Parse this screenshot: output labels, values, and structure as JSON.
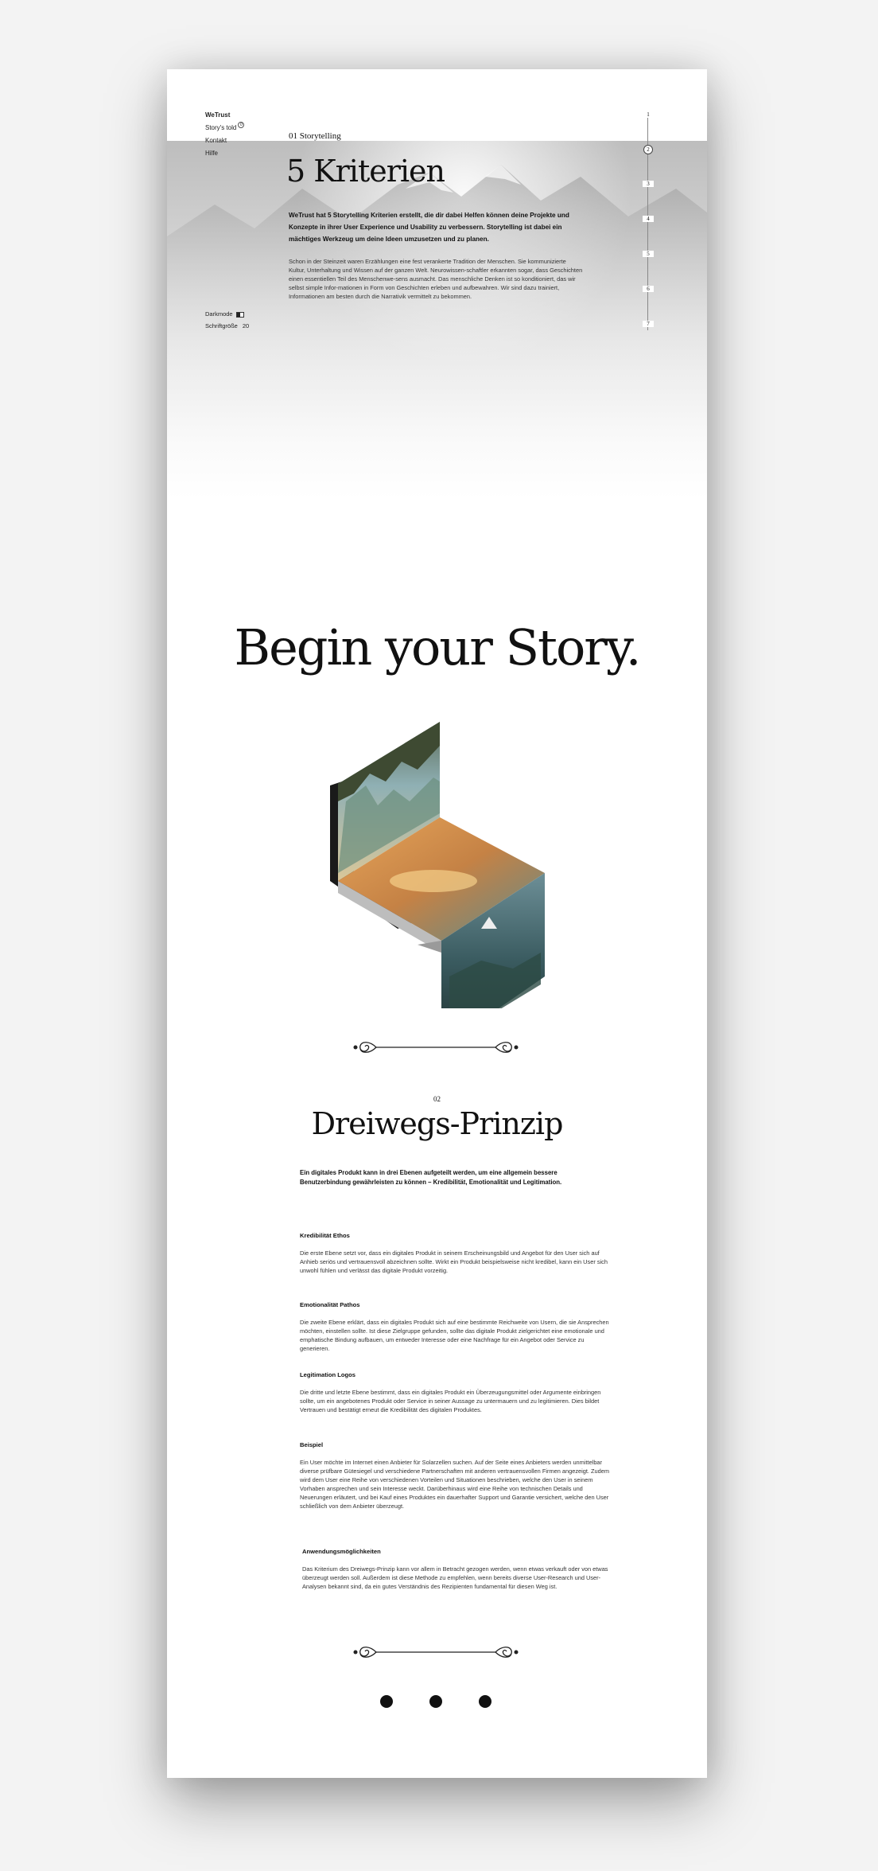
{
  "sidebar": {
    "brand": "WeTrust",
    "items": [
      {
        "label": "Story's told",
        "badge": "0"
      },
      {
        "label": "Kontakt"
      },
      {
        "label": "Hilfe"
      }
    ],
    "darkmode_label": "Darkmode",
    "fontsize_label": "Schriftgröße",
    "fontsize_value": "20"
  },
  "pager": [
    "1",
    "2",
    "3",
    "4",
    "5",
    "6",
    "7"
  ],
  "section1": {
    "number": "01 Storytelling",
    "title": "5 Kriterien",
    "lead": "WeTrust hat 5 Storytelling Kriterien erstellt, die dir dabei Helfen können deine Projekte und Konzepte in ihrer User Experience und Usability zu verbessern. Storytelling ist dabei ein mächtiges Werkzeug um deine Ideen umzusetzen und zu planen.",
    "body": "Schon in der Steinzeit waren Erzählungen eine fest verankerte Tradition der Menschen. Sie kommunizierte Kultur, Unterhaltung und Wissen auf der ganzen Welt. Neurowissen-schaftler erkannten sogar, dass Geschichten einen essentiellen Teil des Menschenwe-sens ausmacht. Das menschliche Denken ist so konditioniert, das wir selbst simple Infor-mationen in Form von Geschichten erleben und aufbewahren. Wir sind dazu trainiert, Informationen am besten durch die Narrativik vermittelt zu bekommen."
  },
  "hero": {
    "title": "Begin your Story."
  },
  "section2": {
    "number": "02",
    "title": "Dreiwegs-Prinzip",
    "lead": "Ein digitales Produkt kann in drei Ebenen aufgeteilt werden, um eine allgemein bessere Benutzerbindung gewährleisten zu können – Kredibilität, Emotionalität und Legitimation.",
    "blocks": [
      {
        "heading": "Kredibilität Ethos",
        "text": "Die erste Ebene setzt vor, dass ein digitales Produkt in seinem Erscheinungsbild und Angebot für den User sich auf Anhieb seriös und vertrauensvoll abzeichnen sollte. Wirkt ein Produkt beispielsweise nicht kredibel, kann ein User sich unwohl fühlen und verlässt das digitale Produkt vorzeitig."
      },
      {
        "heading": "Emotionalität Pathos",
        "text": "Die zweite Ebene erklärt, dass ein digitales Produkt sich auf eine bestimmte Reichweite von Usern, die sie Ansprechen möchten, einstellen sollte. Ist diese Zielgruppe gefunden, sollte das digitale Produkt zielgerichtet eine emotionale und emphatische Bindung aufbauen, um entweder Interesse oder eine Nachfrage für ein Angebot oder Service zu generieren."
      },
      {
        "heading": "Legitimation Logos",
        "text": "Die dritte und letzte Ebene bestimmt, dass ein digitales Produkt ein Überzeugungsmittel oder Argumente einbringen sollte, um ein angebotenes Produkt oder Service in seiner Aussage zu untermauern und zu legitimieren. Dies bildet Vertrauen und bestätigt erneut die Kredibilität des digitalen Produktes."
      },
      {
        "heading": "Beispiel",
        "text": "Ein User möchte im Internet einen Anbieter für Solarzellen suchen. Auf der Seite eines Anbieters werden unmittelbar diverse prüfbare Gütesiegel und verschiedene Partnerschaften mit anderen vertrauensvollen Firmen angezeigt. Zudem wird dem User eine Reihe von verschiedenen Vorteilen und Situationen beschrieben, welche den User in seinem Vorhaben ansprechen und sein Interesse weckt. Darüberhinaus wird eine Reihe von technischen Details und Neuerungen erläutert, und bei Kauf eines Produktes ein dauerhafter Support und Garantie versichert, welche den User schließlich von dem Anbieter überzeugt."
      },
      {
        "heading": "Anwendungsmöglichkeiten",
        "text": "Das Kriterium des Dreiwegs-Prinzip kann vor allem in Betracht gezogen werden, wenn etwas verkauft oder von etwas überzeugt werden soll. Außerdem ist diese Methode zu empfehlen, wenn bereits diverse User-Research und User-Analysen bekannt sind, da ein gutes Verständnis des Rezipienten fundamental für diesen Weg ist."
      }
    ]
  },
  "colors": {
    "background": "#f3f3f3",
    "page": "#ffffff",
    "text": "#111111"
  }
}
